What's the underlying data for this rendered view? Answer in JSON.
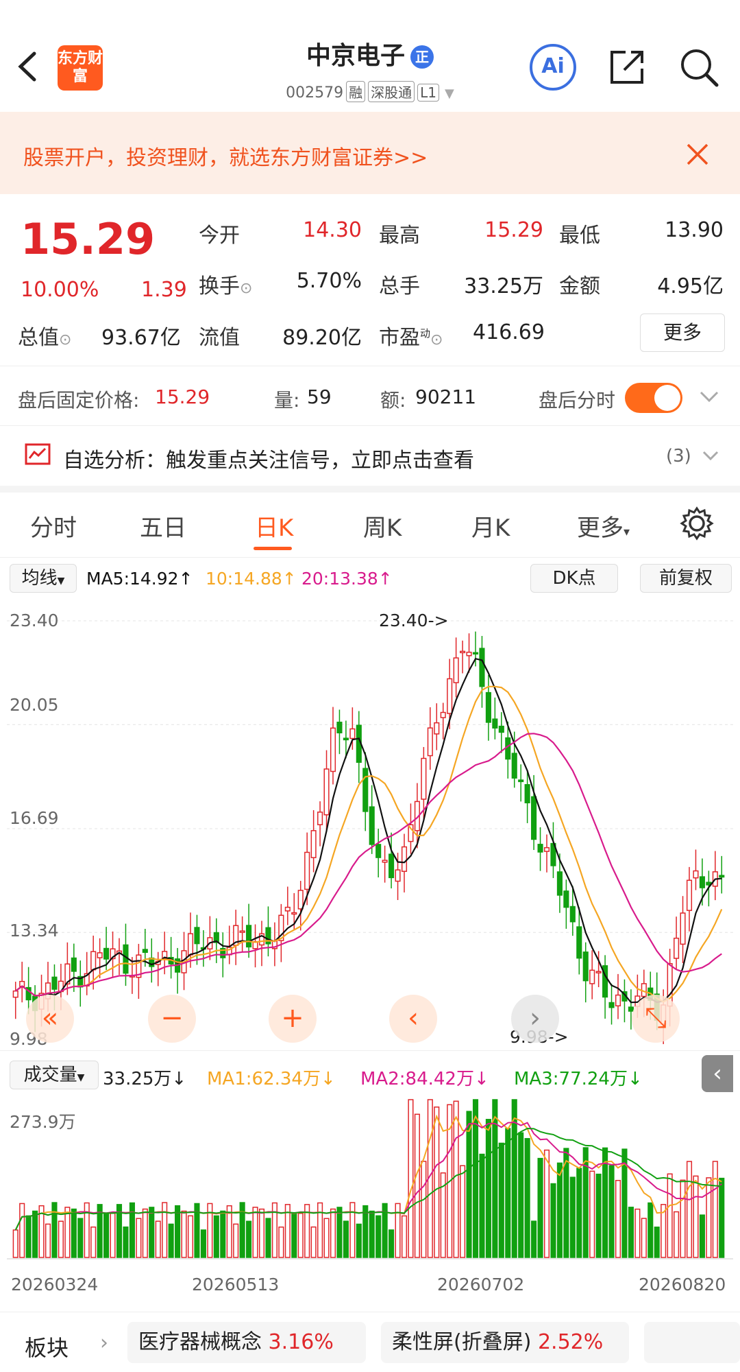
{
  "header": {
    "back_icon": "chevron-left-icon",
    "logo_text": "东方财富",
    "stock_name": "中京电子",
    "badge": "正",
    "code": "002579",
    "tags": [
      "融",
      "深股通",
      "L1"
    ],
    "ai_label": "Ai",
    "share_icon": "share-icon",
    "search_icon": "search-icon"
  },
  "banner": {
    "text": "股票开户，投资理财，就选东方财富证券>>"
  },
  "quote": {
    "price": "15.29",
    "change_pct": "10.00%",
    "change": "1.39",
    "open_label": "今开",
    "open": "14.30",
    "high_label": "最高",
    "high": "15.29",
    "low_label": "最低",
    "low": "13.90",
    "turnover_label": "换手",
    "turnover": "5.70%",
    "volume_label": "总手",
    "volume": "33.25万",
    "amount_label": "金额",
    "amount": "4.95亿",
    "mcap_label": "总值",
    "mcap": "93.67亿",
    "float_label": "流值",
    "float": "89.20亿",
    "pe_label": "市盈",
    "pe_sup": "动",
    "pe": "416.69",
    "more_label": "更多"
  },
  "after_hours": {
    "price_label": "盘后固定价格:",
    "price": "15.29",
    "vol_label": "量:",
    "vol": "59",
    "amt_label": "额:",
    "amt": "90211",
    "toggle_label": "盘后分时"
  },
  "analysis": {
    "text": "自选分析：触发重点关注信号，立即点击查看",
    "count": "(3)"
  },
  "tabs": [
    "分时",
    "五日",
    "日K",
    "周K",
    "月K",
    "更多"
  ],
  "ma_bar": {
    "selector": "均线",
    "ma5": "MA5:14.92↑",
    "ma10": "10:14.88↑",
    "ma20": "20:13.38↑",
    "dk": "DK点",
    "adjust": "前复权"
  },
  "colors": {
    "up": "#e0262a",
    "down": "#11a011",
    "ma5": "#111111",
    "ma10": "#f5a623",
    "ma20": "#d81b8c",
    "accent": "#ff5a1f"
  },
  "price_axis": [
    "23.40",
    "20.05",
    "16.69",
    "13.34",
    "9.98"
  ],
  "price_annotations": {
    "high": "23.40->",
    "low": "9.98->"
  },
  "volume_bar": {
    "selector": "成交量",
    "vol": "33.25万↓",
    "ma1": "MA1:62.34万↓",
    "ma2": "MA2:84.42万↓",
    "ma3": "MA3:77.24万↓",
    "axis_top": "273.9万"
  },
  "date_axis": [
    "20260324",
    "20260513",
    "20260702",
    "20260820"
  ],
  "sectors": {
    "label": "板块",
    "items": [
      {
        "name": "医疗器械概念",
        "pct": "3.16%"
      },
      {
        "name": "柔性屏(折叠屏)",
        "pct": "2.52%"
      }
    ]
  },
  "chart_data": {
    "type": "candlestick",
    "y_range": [
      9.98,
      23.4
    ],
    "annotations": {
      "max": 23.4,
      "min": 9.98
    },
    "x_labels": [
      "20260324",
      "20260513",
      "20260702",
      "20260820"
    ],
    "last_close": 15.29,
    "volume_axis_max": "273.9万"
  }
}
